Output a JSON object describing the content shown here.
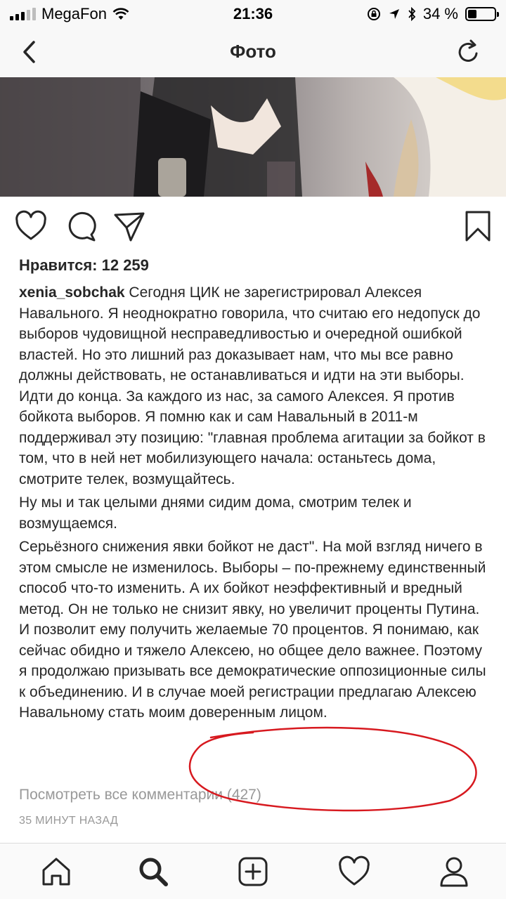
{
  "status_bar": {
    "carrier": "MegaFon",
    "time": "21:36",
    "battery": "34 %",
    "battery_level": 0.34
  },
  "nav": {
    "title": "Фото",
    "back_icon": "chevron-left-icon",
    "refresh_icon": "refresh-icon"
  },
  "post": {
    "likes_text": "Нравится: 12 259",
    "username": "xenia_sobchak",
    "caption_first": " Сегодня ЦИК не зарегистрировал Алексея Навального. Я неоднократно говорила, что считаю его недопуск до выборов чудовищной несправедливостью и очередной ошибкой властей. Но это лишний раз доказывает нам, что мы все равно должны действовать, не останавливаться и идти на эти выборы. Идти до конца. За каждого из нас, за самого Алексея. Я против бойкота выборов. Я помню как и сам Навальный в 2011-м поддерживал эту позицию: \"главная проблема агитации за бойкот в том, что в ней нет мобилизующего начала: останьтесь дома, смотрите телек, возмущайтесь.",
    "caption_second": "Ну мы и так целыми днями сидим дома, смотрим телек и возмущаемся.",
    "caption_third": "Серьёзного снижения явки бойкот не даст\". На мой взгляд ничего в этом смысле не изменилось. Выборы – по-прежнему единственный способ что-то изменить. А их бойкот неэффективный и вредный метод. Он не только не снизит явку, но увеличит проценты Путина. И позволит ему получить желаемые 70 процентов. Я понимаю, как сейчас обидно и тяжело Алексею, но общее дело важнее. Поэтому я продолжаю призывать все демократические оппозиционные силы к объединению. И в случае моей регистрации предлагаю Алексею Навальному стать моим доверенным лицом.",
    "view_comments": "Посмотреть все комментарии (427)",
    "time_ago": "35 МИНУТ НАЗАД"
  },
  "actions": [
    "heart-icon",
    "comment-icon",
    "share-icon",
    "bookmark-icon"
  ],
  "tabs": [
    "home-icon",
    "search-icon",
    "add-post-icon",
    "activity-heart-icon",
    "profile-icon"
  ],
  "colors": {
    "annotation_red": "#d7191f",
    "text": "#262626",
    "muted": "#999999"
  }
}
